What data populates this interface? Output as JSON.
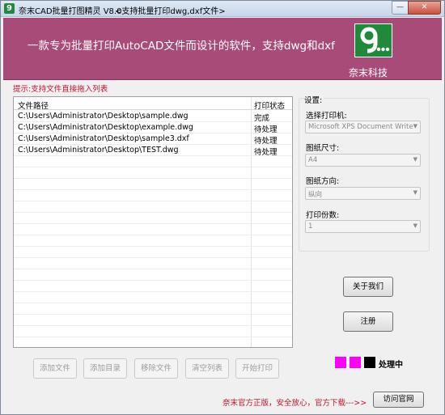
{
  "window": {
    "app_icon_glyph": "9",
    "title": "奈末CAD批量打图精灵 V8.0",
    "subtitle": "<支持批量打印dwg,dxf文件>",
    "minimize_glyph": "—",
    "close_glyph": "✕"
  },
  "banner": {
    "slogan": "一款专为批量打印AutoCAD文件而设计的软件，支持dwg和dxf",
    "logo_text": "奈末科技",
    "color": "#a94b78"
  },
  "hint": "提示:支持文件直接拖入列表",
  "file_list": {
    "columns": [
      "文件路径",
      "打印状态"
    ],
    "rows": [
      {
        "path": "C:\\Users\\Administrator\\Desktop\\sample.dwg",
        "status": "完成"
      },
      {
        "path": "C:\\Users\\Administrator\\Desktop\\example.dwg",
        "status": "待处理"
      },
      {
        "path": "C:\\Users\\Administrator\\Desktop\\sample3.dxf",
        "status": "待处理"
      },
      {
        "path": "C:\\Users\\Administrator\\Desktop\\TEST.dwg",
        "status": "待处理"
      }
    ]
  },
  "buttons": {
    "add_file": "添加文件",
    "add_dir": "添加目录",
    "remove_file": "移除文件",
    "clear_list": "清空列表",
    "start_print": "开始打印",
    "about": "关于我们",
    "register": "注册",
    "visit_site": "访问官网"
  },
  "settings": {
    "title": "设置:",
    "printer_label": "选择打印机:",
    "printer_value": "Microsoft XPS Document Write",
    "paper_label": "图纸尺寸:",
    "paper_value": "A4",
    "orientation_label": "图纸方向:",
    "orientation_value": "纵向",
    "copies_label": "打印份数:",
    "copies_value": "1"
  },
  "status": {
    "text": "处理中",
    "indicator_colors": [
      "#ff00ff",
      "#ff00ff",
      "#000000"
    ]
  },
  "footer": "奈末官方正版，安全放心，官方下载--->>"
}
